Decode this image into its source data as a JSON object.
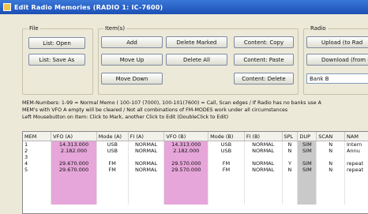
{
  "window": {
    "title": "Edit Radio Memories (RADIO 1: IC-7600)"
  },
  "file_group": {
    "label": "File",
    "open_label": "List: Open",
    "save_as_label": "List: Save As"
  },
  "item_group": {
    "label": "Item(s)",
    "add_label": "Add",
    "move_up_label": "Move Up",
    "move_down_label": "Move Down",
    "delete_marked_label": "Delete Marked",
    "delete_all_label": "Delete All",
    "content_copy_label": "Content: Copy",
    "content_paste_label": "Content: Paste",
    "content_delete_label": "Content: Delete"
  },
  "radio_group": {
    "label": "Radio",
    "upload_label": "Upload (to Rad",
    "download_label": "Download (from R",
    "bank_value": "Bank B"
  },
  "info_lines": [
    "MEM-Numbers: 1-99 = Normal Memo ( 100-107 (7000), 100-101(7600) = Call, Scan edges / If Radio has no banks use A",
    "MEM's with VFO A empty will be cleared / Not all combinations of FM-MODES work under all circumstances",
    "Left Mousebutton on Item: Click to Mark, another Click to Edit (DoubleClick to Edit)"
  ],
  "table": {
    "columns": [
      "MEM",
      "VFO (A)",
      "Mode (A)",
      "FI (A)",
      "VFO (B)",
      "Mode (B)",
      "FI (B)",
      "SPL",
      "DUP",
      "SCAN",
      "NAM"
    ],
    "rows": [
      [
        "1",
        "14.313.000",
        "USB",
        "NORMAL",
        "14.313.000",
        "USB",
        "NORMAL",
        "N",
        "SIM",
        "N",
        "Intern"
      ],
      [
        "2",
        "2.182.000",
        "USB",
        "NORMAL",
        "2.182.000",
        "USB",
        "NORMAL",
        "N",
        "SIM",
        "N",
        "Annu"
      ],
      [
        "3",
        "",
        "",
        "",
        "",
        "",
        "",
        "",
        "",
        "",
        ""
      ],
      [
        "4",
        "29.670.000",
        "FM",
        "NORMAL",
        "29.570.000",
        "FM",
        "NORMAL",
        "Y",
        "SIM",
        "N",
        "repeat"
      ],
      [
        "5",
        "29.670.000",
        "FM",
        "NORMAL",
        "29.570.000",
        "FM",
        "NORMAL",
        "N",
        "SIM",
        "N",
        "repeat"
      ]
    ]
  },
  "colors": {
    "vfo_highlight": "#e6a6d9",
    "dup_highlight": "#c9c9c9",
    "titlebar": "#1c4fb5"
  }
}
